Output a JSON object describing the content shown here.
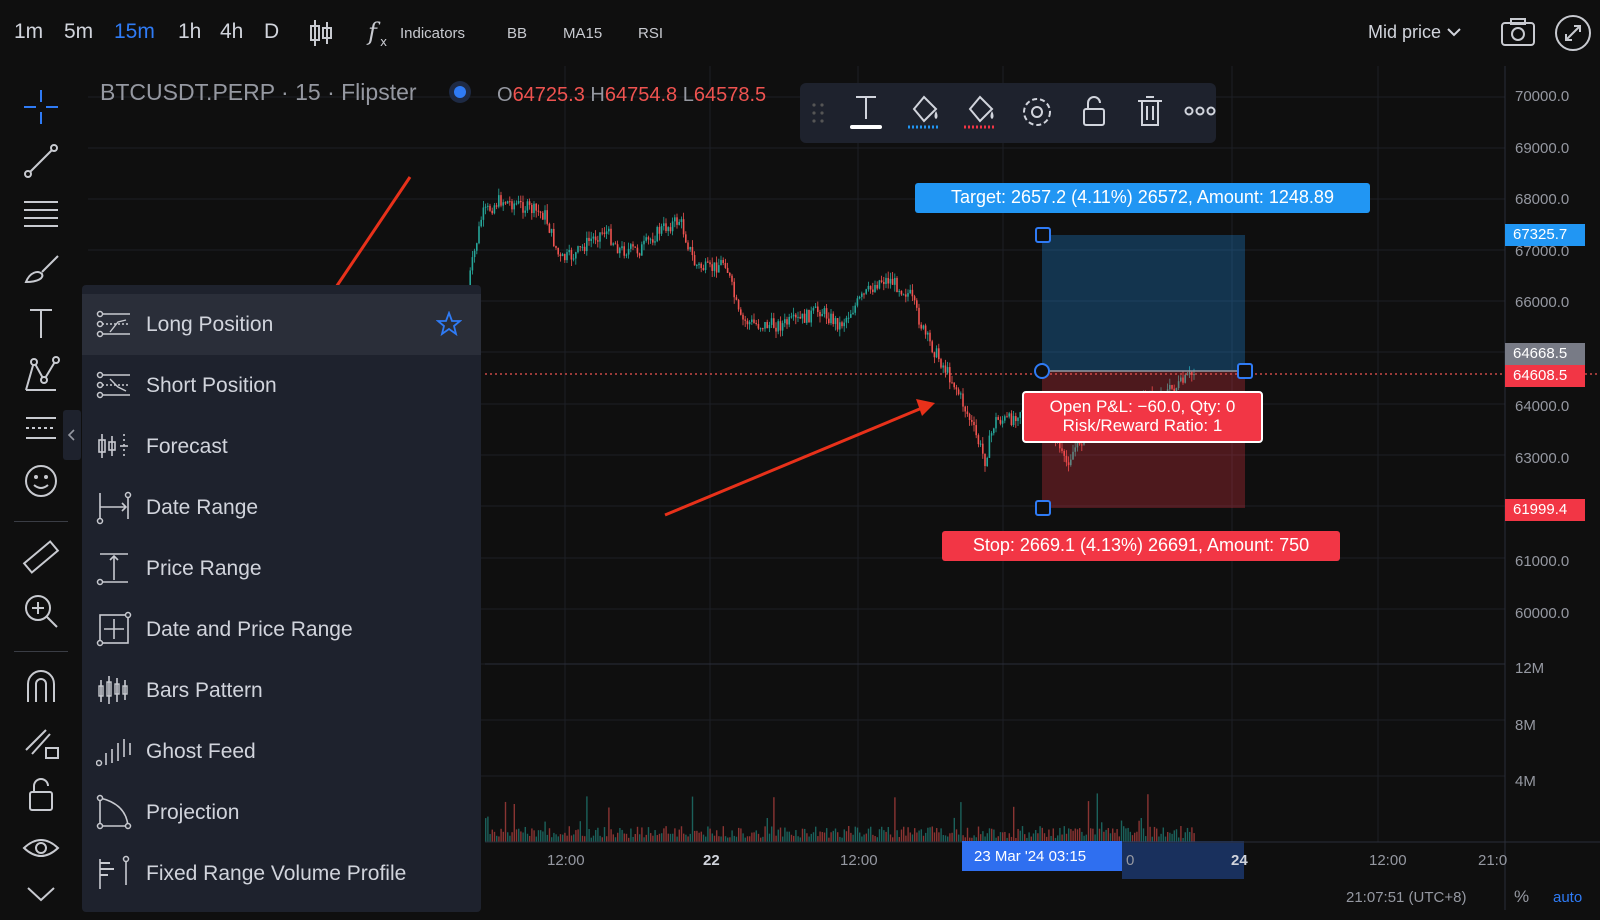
{
  "toolbar": {
    "timeframes": [
      "1m",
      "5m",
      "15m",
      "1h",
      "4h",
      "D"
    ],
    "active_timeframe": "15m",
    "indicators_label": "Indicators",
    "studies": [
      "BB",
      "MA15",
      "RSI"
    ],
    "price_source": "Mid price"
  },
  "legend": {
    "symbol": "BTCUSDT.PERP · 15 · Flipster",
    "o_label": "O",
    "o_value": "64725.3",
    "h_label": "H",
    "h_value": "64754.8",
    "l_label": "L",
    "l_value": "64578.5"
  },
  "price_axis": {
    "labels": [
      "70000.0",
      "69000.0",
      "68000.0",
      "67000.0",
      "66000.0",
      "64000.0",
      "63000.0",
      "61000.0",
      "60000.0"
    ],
    "volume_labels": [
      "12M",
      "8M",
      "4M"
    ],
    "target_tag": "67325.7",
    "last_price_tag": "64668.5",
    "entry_tag": "64608.5",
    "stop_tag": "61999.4"
  },
  "position": {
    "target_label": "Target: 2657.2 (4.11%) 26572, Amount: 1248.89",
    "stop_label": "Stop: 2669.1 (4.13%) 26691, Amount: 750",
    "pnl_line1": "Open P&L: −60.0, Qty: 0",
    "pnl_line2": "Risk/Reward Ratio: 1"
  },
  "time_axis": {
    "labels": [
      "12:00",
      "22",
      "12:00",
      "0",
      "24",
      "12:00",
      "21:0"
    ],
    "crosshair": "23 Mar '24   03:15",
    "clock": "21:07:51 (UTC+8)",
    "percent": "%",
    "auto": "auto"
  },
  "menu": {
    "items": [
      {
        "label": "Long Position",
        "icon": "long-position-icon"
      },
      {
        "label": "Short Position",
        "icon": "short-position-icon"
      },
      {
        "label": "Forecast",
        "icon": "forecast-icon"
      },
      {
        "label": "Date Range",
        "icon": "date-range-icon"
      },
      {
        "label": "Price Range",
        "icon": "price-range-icon"
      },
      {
        "label": "Date and Price Range",
        "icon": "date-price-range-icon"
      },
      {
        "label": "Bars Pattern",
        "icon": "bars-pattern-icon"
      },
      {
        "label": "Ghost Feed",
        "icon": "ghost-feed-icon"
      },
      {
        "label": "Projection",
        "icon": "projection-icon"
      },
      {
        "label": "Fixed Range Volume Profile",
        "icon": "volume-profile-icon"
      }
    ]
  },
  "colors": {
    "up": "#26a69a",
    "down": "#ef5350",
    "accent": "#2f7bf5",
    "target_zone": "#2196f3",
    "stop_zone": "#f23645"
  }
}
